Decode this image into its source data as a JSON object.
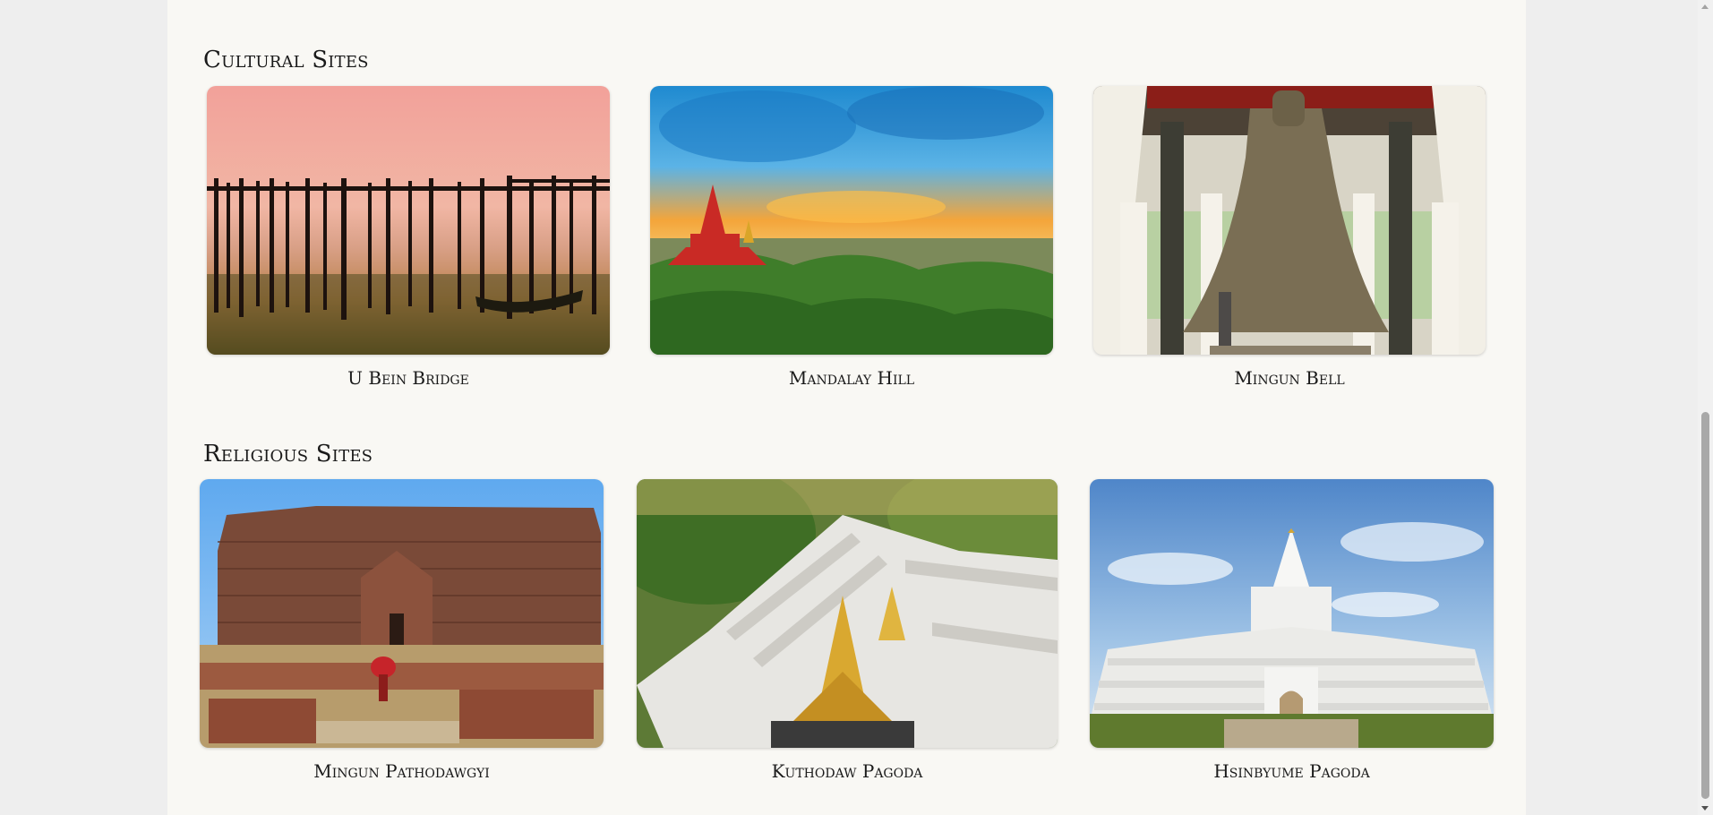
{
  "sections": [
    {
      "title": "Cultural Sites",
      "cards": [
        {
          "title": "U Bein Bridge",
          "image": "u-bein-bridge-sunset-photo"
        },
        {
          "title": "Mandalay Hill",
          "image": "mandalay-hill-sunset-photo"
        },
        {
          "title": "Mingun Bell",
          "image": "mingun-bell-photo"
        }
      ]
    },
    {
      "title": "Religious Sites",
      "cards": [
        {
          "title": "Mingun Pathodawgyi",
          "image": "mingun-pathodawgyi-photo"
        },
        {
          "title": "Kuthodaw Pagoda",
          "image": "kuthodaw-pagoda-aerial-photo"
        },
        {
          "title": "Hsinbyume Pagoda",
          "image": "hsinbyume-pagoda-photo"
        }
      ]
    }
  ],
  "scrollbar": {
    "position_fraction": 0.78
  }
}
